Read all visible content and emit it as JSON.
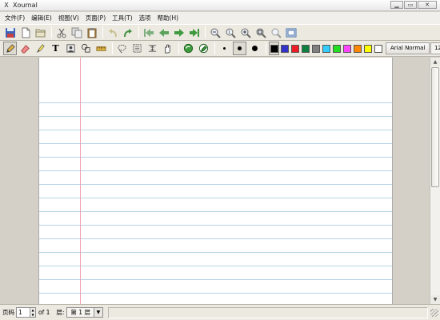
{
  "window": {
    "title": "Xournal",
    "app_icon": "X",
    "min_label": "▁",
    "max_label": "▭",
    "close_label": "✕"
  },
  "menu": [
    "文件(F)",
    "编辑(E)",
    "视图(V)",
    "页面(P)",
    "工具(T)",
    "选项",
    "帮助(H)"
  ],
  "toolbar1": {
    "icons": [
      "save-icon",
      "new-document-icon",
      "open-folder-icon",
      "cut-icon",
      "copy-icon",
      "paste-icon",
      "undo-icon",
      "redo-icon",
      "first-page-icon",
      "previous-page-icon",
      "next-page-icon",
      "last-page-icon",
      "zoom-out-icon",
      "zoom-normal-icon",
      "zoom-in-icon",
      "zoom-fit-icon",
      "zoom-set-icon",
      "fullscreen-icon"
    ]
  },
  "toolbar2": {
    "icons": [
      "pen-icon",
      "eraser-icon",
      "highlighter-icon",
      "text-icon",
      "image-icon",
      "shape-recognizer-icon",
      "ruler-icon",
      "lasso-select-icon",
      "rect-select-icon",
      "vertical-space-icon",
      "hand-icon",
      "default-tool-icon",
      "default-pen-icon"
    ],
    "colors": [
      "#000000",
      "#3333cc",
      "#ee1c24",
      "#108040",
      "#808080",
      "#33ccff",
      "#22dd22",
      "#ff44ff",
      "#ff8800",
      "#ffff00",
      "#ffffff"
    ],
    "text_tool_glyph": "T",
    "font_button": "Arial Normal",
    "font_size": "12"
  },
  "statusbar": {
    "page_label": "页码",
    "page_value": "1",
    "page_total": "of 1",
    "layer_label": "层:",
    "layer_value": "第 1 层"
  },
  "colors": {
    "ruling": "#b7d3e6",
    "margin": "#f2a1b0",
    "chrome": "#ece9e0"
  }
}
